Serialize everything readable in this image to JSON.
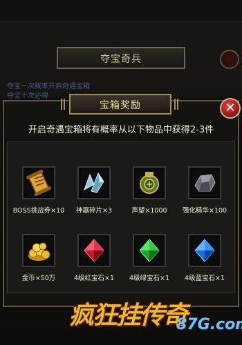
{
  "background": {
    "window_title": "夺宝奇兵",
    "line1": "夺宝一次概率开启奇遇宝箱",
    "line2": "夺宝十次必得"
  },
  "dialog": {
    "title": "宝箱奖励",
    "description": "开启奇遇宝箱将有概率从以下物品中获得2-3件",
    "close_icon": "close-icon"
  },
  "items": [
    {
      "label": "BOSS挑战券×10",
      "icon": "scroll-icon"
    },
    {
      "label": "神器碎片×3",
      "icon": "crystal-shard-icon"
    },
    {
      "label": "声望×1000",
      "icon": "jade-token-icon"
    },
    {
      "label": "强化精华×100",
      "icon": "ore-icon"
    },
    {
      "label": "金币×50万",
      "icon": "gold-coins-icon"
    },
    {
      "label": "4级红宝石×1",
      "icon": "red-gem-icon"
    },
    {
      "label": "4级绿宝石×1",
      "icon": "green-gem-icon"
    },
    {
      "label": "4级蓝宝石×1",
      "icon": "blue-gem-icon"
    }
  ],
  "logo": {
    "text": "疯狂挂传奇",
    "site": "87G.com"
  }
}
